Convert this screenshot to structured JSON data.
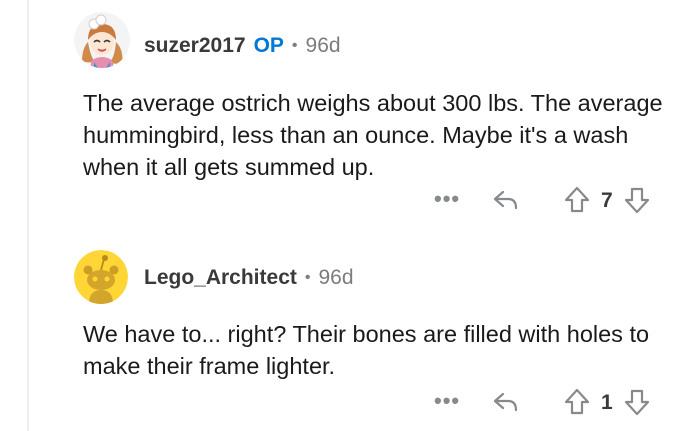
{
  "comments": [
    {
      "username": "suzer2017",
      "op_badge": "OP",
      "separator": "•",
      "age": "96d",
      "text": "The average ostrich weighs about 300 lbs. The average hummingbird, less than an ounce. Maybe it's a wash when it all gets summed up.",
      "more_label": "•••",
      "vote_count": "7",
      "avatar_icon": "anime-girl-avatar"
    },
    {
      "username": "Lego_Architect",
      "separator": "•",
      "age": "96d",
      "text": "We have to... right? Their bones are filled with holes to make their frame lighter.",
      "more_label": "•••",
      "vote_count": "1",
      "avatar_icon": "snoo-avatar"
    }
  ],
  "colors": {
    "op_blue": "#0079d3",
    "snoo_bg": "#ffd635",
    "muted": "#7c7c7c"
  }
}
